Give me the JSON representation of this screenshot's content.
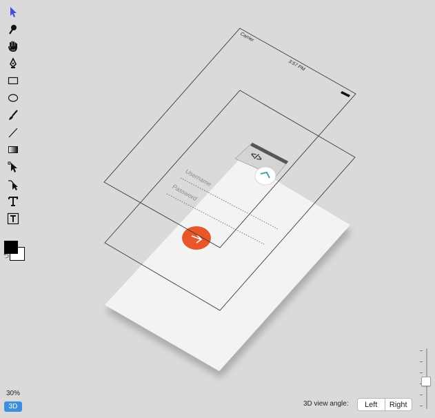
{
  "toolbar": {
    "tools": [
      {
        "name": "select-arrow-icon",
        "active": true
      },
      {
        "name": "magnify-brush-icon"
      },
      {
        "name": "hand-icon"
      },
      {
        "name": "pen-icon"
      },
      {
        "name": "rectangle-icon"
      },
      {
        "name": "ellipse-icon"
      },
      {
        "name": "brush-icon"
      },
      {
        "name": "line-icon"
      },
      {
        "name": "gradient-icon"
      },
      {
        "name": "direct-select-icon"
      },
      {
        "name": "node-select-icon"
      },
      {
        "name": "text-icon"
      },
      {
        "name": "text-box-icon"
      }
    ],
    "colors": {
      "foreground": "#000000",
      "background": "#ffffff"
    },
    "swap_glyph": "⮌"
  },
  "view": {
    "zoom": "30%",
    "mode_button": "3D",
    "angle_label": "3D view angle:",
    "angle_options": [
      "Left",
      "Right"
    ],
    "slider_level": 0.45
  },
  "artboard": {
    "status_carrier": "Carrier",
    "status_time": "3:57 PM",
    "username_placeholder": "Username",
    "password_placeholder": "Password",
    "code_glyph": "</>",
    "submit_color": "#e8572a",
    "accent_color": "#3aa7a8",
    "toolbar_accent": "#3d8fdc"
  }
}
